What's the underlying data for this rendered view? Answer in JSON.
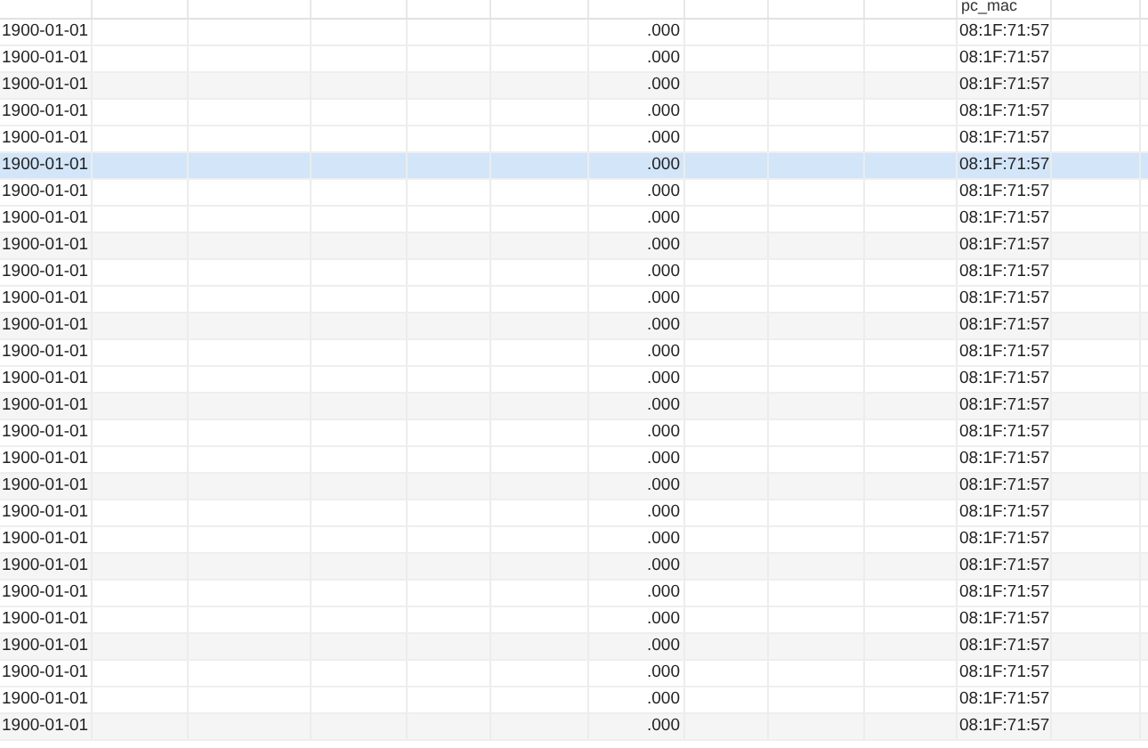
{
  "header": {
    "column_11": "pc_mac"
  },
  "rows": [
    {
      "date": "1900-01-01",
      "amount": ".000",
      "mac": "08:1F:71:57",
      "selected": false
    },
    {
      "date": "1900-01-01",
      "amount": ".000",
      "mac": "08:1F:71:57",
      "selected": false
    },
    {
      "date": "1900-01-01",
      "amount": ".000",
      "mac": "08:1F:71:57",
      "selected": false
    },
    {
      "date": "1900-01-01",
      "amount": ".000",
      "mac": "08:1F:71:57",
      "selected": false
    },
    {
      "date": "1900-01-01",
      "amount": ".000",
      "mac": "08:1F:71:57",
      "selected": false
    },
    {
      "date": "1900-01-01",
      "amount": ".000",
      "mac": "08:1F:71:57",
      "selected": true
    },
    {
      "date": "1900-01-01",
      "amount": ".000",
      "mac": "08:1F:71:57",
      "selected": false
    },
    {
      "date": "1900-01-01",
      "amount": ".000",
      "mac": "08:1F:71:57",
      "selected": false
    },
    {
      "date": "1900-01-01",
      "amount": ".000",
      "mac": "08:1F:71:57",
      "selected": false
    },
    {
      "date": "1900-01-01",
      "amount": ".000",
      "mac": "08:1F:71:57",
      "selected": false
    },
    {
      "date": "1900-01-01",
      "amount": ".000",
      "mac": "08:1F:71:57",
      "selected": false
    },
    {
      "date": "1900-01-01",
      "amount": ".000",
      "mac": "08:1F:71:57",
      "selected": false
    },
    {
      "date": "1900-01-01",
      "amount": ".000",
      "mac": "08:1F:71:57",
      "selected": false
    },
    {
      "date": "1900-01-01",
      "amount": ".000",
      "mac": "08:1F:71:57",
      "selected": false
    },
    {
      "date": "1900-01-01",
      "amount": ".000",
      "mac": "08:1F:71:57",
      "selected": false
    },
    {
      "date": "1900-01-01",
      "amount": ".000",
      "mac": "08:1F:71:57",
      "selected": false
    },
    {
      "date": "1900-01-01",
      "amount": ".000",
      "mac": "08:1F:71:57",
      "selected": false
    },
    {
      "date": "1900-01-01",
      "amount": ".000",
      "mac": "08:1F:71:57",
      "selected": false
    },
    {
      "date": "1900-01-01",
      "amount": ".000",
      "mac": "08:1F:71:57",
      "selected": false
    },
    {
      "date": "1900-01-01",
      "amount": ".000",
      "mac": "08:1F:71:57",
      "selected": false
    },
    {
      "date": "1900-01-01",
      "amount": ".000",
      "mac": "08:1F:71:57",
      "selected": false
    },
    {
      "date": "1900-01-01",
      "amount": ".000",
      "mac": "08:1F:71:57",
      "selected": false
    },
    {
      "date": "1900-01-01",
      "amount": ".000",
      "mac": "08:1F:71:57",
      "selected": false
    },
    {
      "date": "1900-01-01",
      "amount": ".000",
      "mac": "08:1F:71:57",
      "selected": false
    },
    {
      "date": "1900-01-01",
      "amount": ".000",
      "mac": "08:1F:71:57",
      "selected": false
    },
    {
      "date": "1900-01-01",
      "amount": ".000",
      "mac": "08:1F:71:57",
      "selected": false
    },
    {
      "date": "1900-01-01",
      "amount": ".000",
      "mac": "08:1F:71:57",
      "selected": false
    }
  ]
}
